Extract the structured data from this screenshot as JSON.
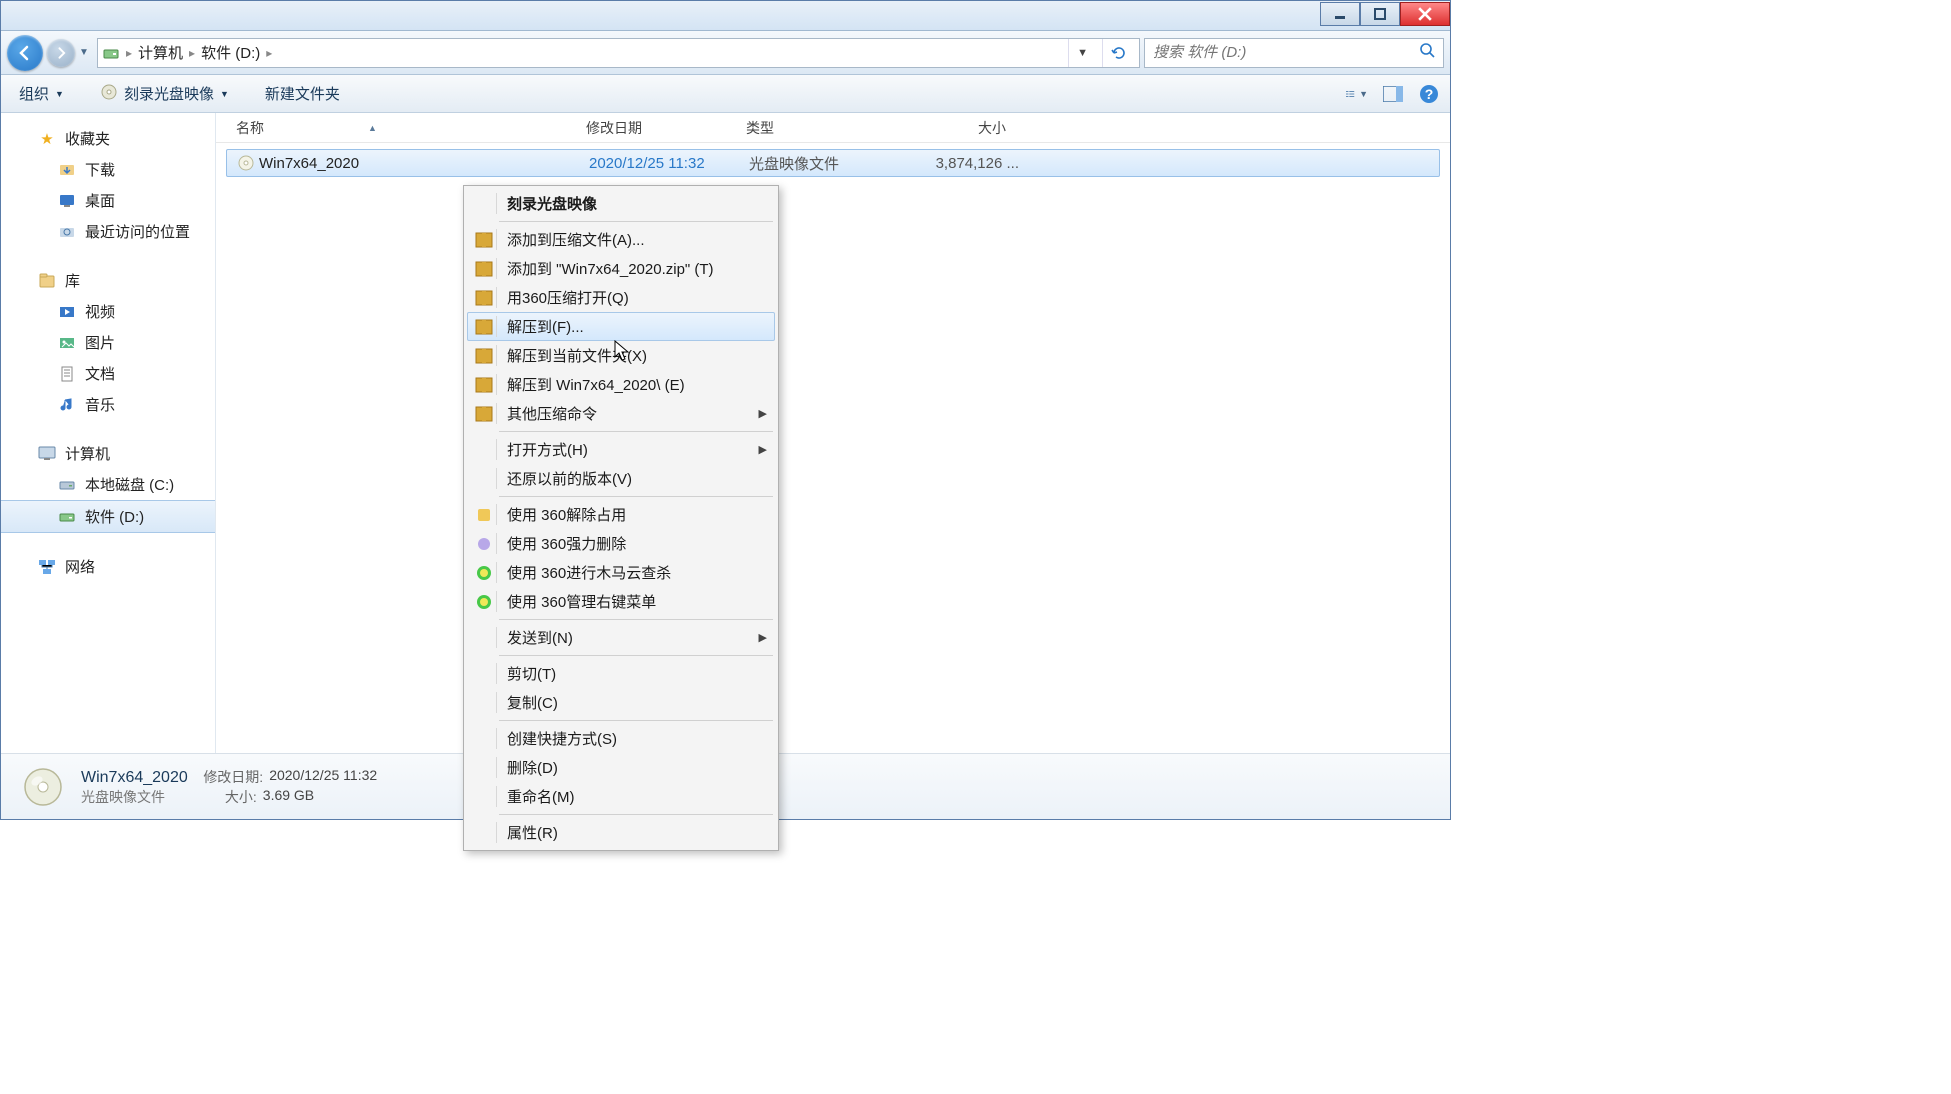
{
  "breadcrumb": {
    "part1": "计算机",
    "part2": "软件 (D:)"
  },
  "search": {
    "placeholder": "搜索 软件 (D:)"
  },
  "toolbar": {
    "organize": "组织",
    "burn": "刻录光盘映像",
    "newFolder": "新建文件夹"
  },
  "sidebar": {
    "favorites": {
      "header": "收藏夹",
      "downloads": "下载",
      "desktop": "桌面",
      "recent": "最近访问的位置"
    },
    "libraries": {
      "header": "库",
      "video": "视频",
      "pictures": "图片",
      "documents": "文档",
      "music": "音乐"
    },
    "computer": {
      "header": "计算机",
      "localC": "本地磁盘 (C:)",
      "softD": "软件 (D:)"
    },
    "network": {
      "header": "网络"
    }
  },
  "columns": {
    "name": "名称",
    "date": "修改日期",
    "type": "类型",
    "size": "大小"
  },
  "file": {
    "name": "Win7x64_2020",
    "date": "2020/12/25 11:32",
    "type": "光盘映像文件",
    "size": "3,874,126 ..."
  },
  "contextMenu": {
    "burn": "刻录光盘映像",
    "addArchive": "添加到压缩文件(A)...",
    "addZip": "添加到 \"Win7x64_2020.zip\" (T)",
    "open360": "用360压缩打开(Q)",
    "extractTo": "解压到(F)...",
    "extractHere": "解压到当前文件夹(X)",
    "extractNamed": "解压到 Win7x64_2020\\ (E)",
    "otherArchive": "其他压缩命令",
    "openWith": "打开方式(H)",
    "restoreVer": "还原以前的版本(V)",
    "unlock360": "使用 360解除占用",
    "forceDel360": "使用 360强力删除",
    "trojan360": "使用 360进行木马云查杀",
    "manage360": "使用 360管理右键菜单",
    "sendTo": "发送到(N)",
    "cut": "剪切(T)",
    "copy": "复制(C)",
    "shortcut": "创建快捷方式(S)",
    "delete": "删除(D)",
    "rename": "重命名(M)",
    "properties": "属性(R)"
  },
  "detail": {
    "name": "Win7x64_2020",
    "type": "光盘映像文件",
    "dateLabel": "修改日期:",
    "date": "2020/12/25 11:32",
    "sizeLabel": "大小:",
    "size": "3.69 GB"
  }
}
